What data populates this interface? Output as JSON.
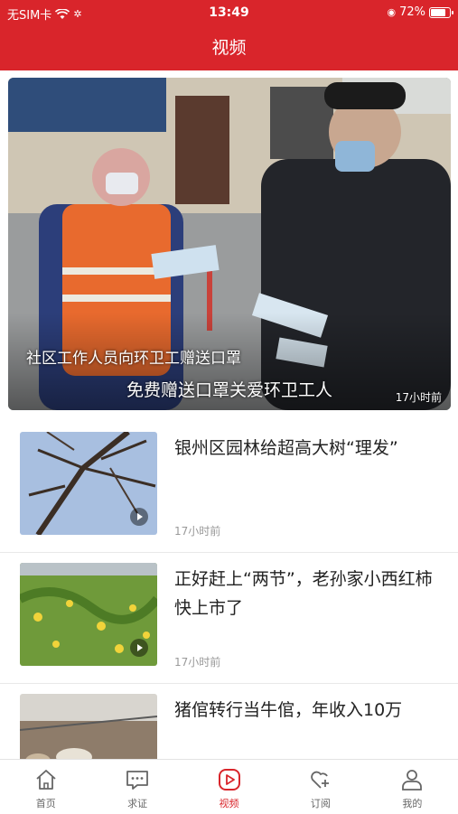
{
  "status": {
    "carrier": "无SIM卡",
    "time": "13:49",
    "battery": "72%"
  },
  "header": {
    "title": "视频"
  },
  "featured": {
    "caption_top": "社区工作人员向环卫工赠送口罩",
    "caption_bottom": "免费赠送口罩关爱环卫工人",
    "time": "17小时前"
  },
  "items": [
    {
      "title": "银州区园林给超高大树“理发”",
      "time": "17小时前"
    },
    {
      "title": "正好赶上“两节”，老孙家小西红柿快上市了",
      "time": "17小时前"
    },
    {
      "title": "猪倌转行当牛倌，年收入10万",
      "time": ""
    }
  ],
  "tabs": [
    {
      "label": "首页",
      "icon": "home-icon"
    },
    {
      "label": "求证",
      "icon": "chat-icon"
    },
    {
      "label": "视频",
      "icon": "play-icon",
      "active": true
    },
    {
      "label": "订阅",
      "icon": "heart-plus-icon"
    },
    {
      "label": "我的",
      "icon": "user-icon"
    }
  ],
  "colors": {
    "brand": "#d9252b"
  }
}
